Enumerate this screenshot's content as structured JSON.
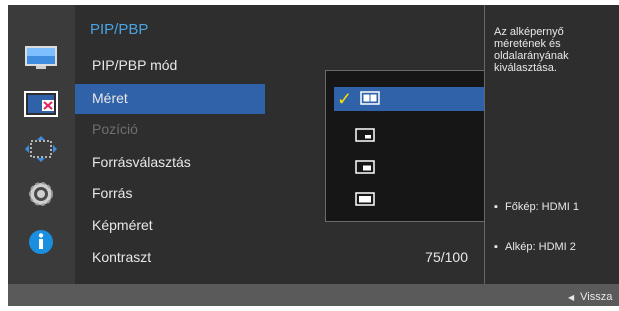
{
  "sidebar": {
    "icons": [
      {
        "name": "picture-icon"
      },
      {
        "name": "pip-pbp-icon",
        "active": true
      },
      {
        "name": "onscreen-display-icon"
      },
      {
        "name": "system-gear-icon"
      },
      {
        "name": "information-icon"
      }
    ]
  },
  "main": {
    "title": "PIP/PBP",
    "items": [
      {
        "label": "PIP/PBP mód",
        "value": ""
      },
      {
        "label": "Méret",
        "value": "",
        "selected": true
      },
      {
        "label": "Pozíció",
        "value": "",
        "disabled": true
      },
      {
        "label": "Forrásválasztás",
        "value": ""
      },
      {
        "label": "Forrás",
        "value": ""
      },
      {
        "label": "Képméret",
        "value": ""
      },
      {
        "label": "Kontraszt",
        "value": "75/100"
      }
    ]
  },
  "size_dropdown": {
    "options": [
      {
        "icon": "size-split-icon",
        "selected": true
      },
      {
        "icon": "size-small-icon"
      },
      {
        "icon": "size-medium-icon"
      },
      {
        "icon": "size-large-icon"
      }
    ]
  },
  "info_panel": {
    "description": "Az alképernyő méretének és oldalarányának kiválasztása.",
    "main_source": "Főkép: HDMI 1",
    "sub_source": "Alkép: HDMI 2"
  },
  "footer": {
    "back_label": "Vissza"
  },
  "colors": {
    "accent_blue": "#2f62a8",
    "title_blue": "#4aa3e0",
    "check_yellow": "#f5e000",
    "info_icon_blue": "#1a8fe0"
  }
}
